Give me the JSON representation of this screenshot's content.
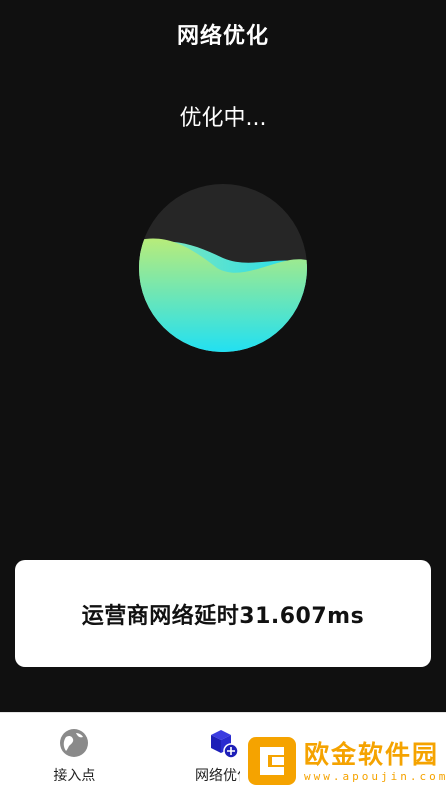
{
  "header": {
    "title": "网络优化"
  },
  "status": {
    "text": "优化中..."
  },
  "result_card": {
    "text": "运营商网络延时31.607ms"
  },
  "progress_ball": {
    "fill_fraction": 0.55,
    "colors": {
      "top": "#b8ec7a",
      "bottom": "#22e0f2",
      "empty": "#2a2a2a"
    }
  },
  "bottom_nav": {
    "items": [
      {
        "label": "接入点",
        "icon": "globe-icon"
      },
      {
        "label": "网络优化",
        "icon": "network-cube-icon"
      },
      {
        "label": "",
        "icon": "document-search-icon"
      }
    ]
  },
  "watermark": {
    "main": "欧金软件园",
    "sub": "www.apoujin.com",
    "color": "#f5a300"
  }
}
